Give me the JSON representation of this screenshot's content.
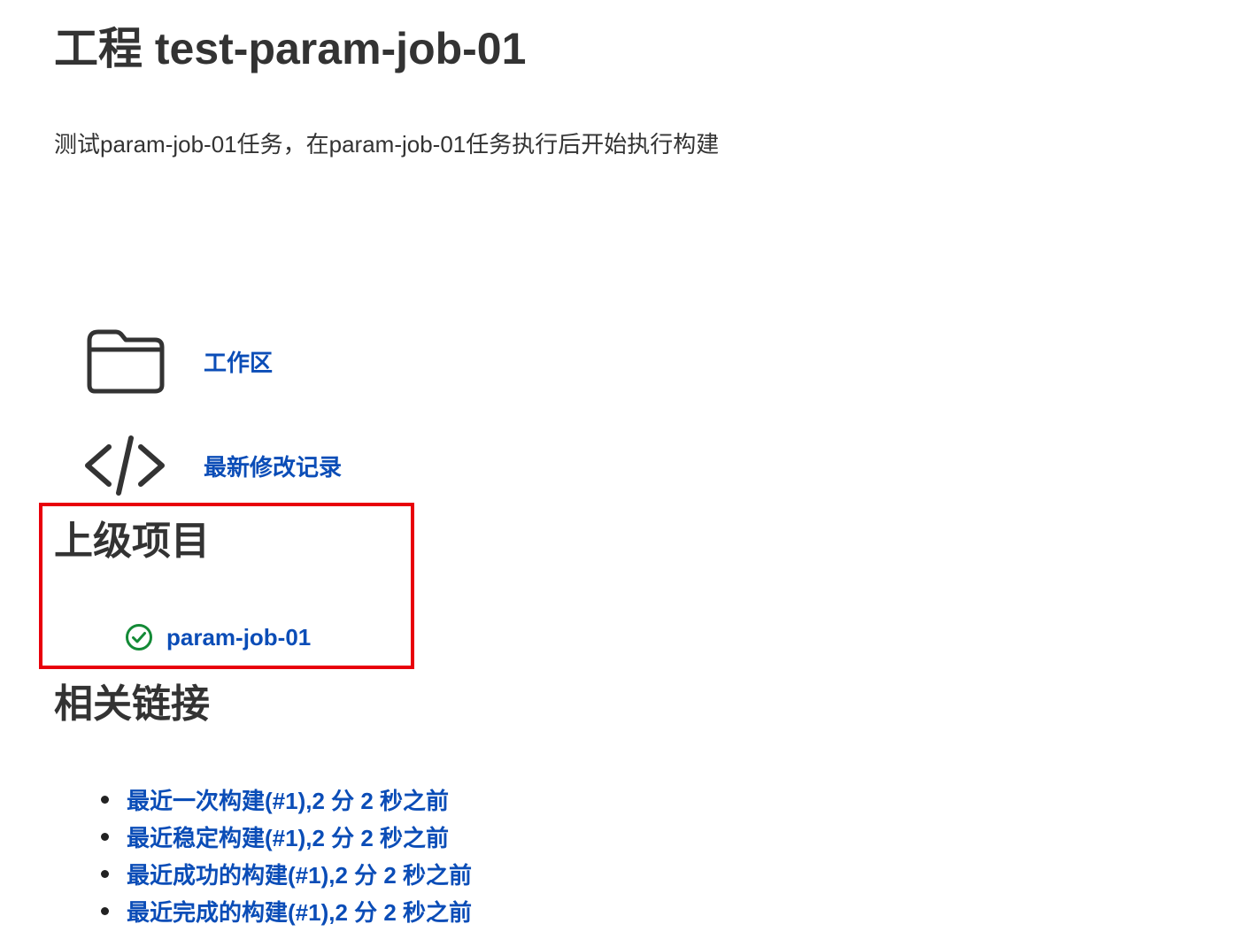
{
  "header": {
    "title": "工程 test-param-job-01",
    "description": "测试param-job-01任务，在param-job-01任务执行后开始执行构建"
  },
  "tasks": [
    {
      "icon": "folder-icon",
      "label": "工作区"
    },
    {
      "icon": "code-icon",
      "label": "最新修改记录"
    }
  ],
  "upstream": {
    "title": "上级项目",
    "items": [
      {
        "icon": "success-check-icon",
        "label": "param-job-01",
        "status_color": "#138a36"
      }
    ]
  },
  "related": {
    "title": "相关链接",
    "links": [
      {
        "label": "最近一次构建(#1),2 分 2 秒之前"
      },
      {
        "label": "最近稳定构建(#1),2 分 2 秒之前"
      },
      {
        "label": "最近成功的构建(#1),2 分 2 秒之前"
      },
      {
        "label": "最近完成的构建(#1),2 分 2 秒之前"
      }
    ]
  },
  "colors": {
    "link": "#0b4db7",
    "text": "#333333",
    "highlight": "#e8000b",
    "success": "#138a36"
  }
}
